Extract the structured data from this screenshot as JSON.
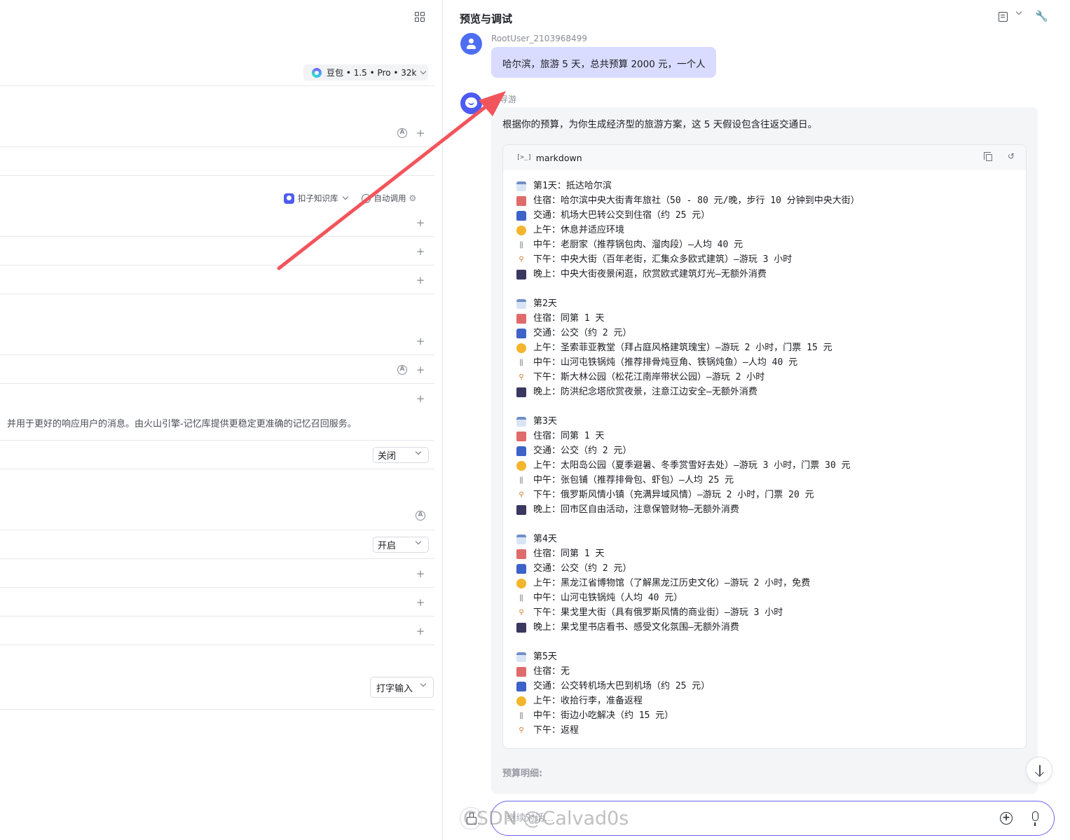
{
  "left_panel": {
    "model_chip": "豆包 • 1.5 • Pro • 32k",
    "knowledge": {
      "kb_label": "扣子知识库",
      "auto_label": "自动调用"
    },
    "memory_description": "并用于更好的响应用户的消息。由火山引擎-记忆库提供更稳定更准确的记忆召回服务。",
    "select_close": "关闭",
    "select_open": "开启",
    "select_input_mode": "打字输入"
  },
  "right_panel": {
    "title": "预览与调试",
    "user": {
      "name": "RootUser_2103968499",
      "message": "哈尔滨，旅游 5 天，总共预算 2000 元，一个人"
    },
    "bot": {
      "name_partial": "能导游",
      "intro": "根据你的预算，为你生成经济型的旅游方案，这 5 天假设包含往返交通日。",
      "code_lang": "markdown",
      "code_lines": [
        {
          "icon": "calendar",
          "text": "第1天：抵达哈尔滨"
        },
        {
          "icon": "hotel",
          "text": "住宿：哈尔滨中央大街青年旅社（50 - 80 元/晚，步行 10 分钟到中央大街）"
        },
        {
          "icon": "bus",
          "text": "交通：机场大巴转公交到住宿（约 25 元）"
        },
        {
          "icon": "sun",
          "text": "上午：休息并适应环境"
        },
        {
          "icon": "fork",
          "text": "中午：老厨家（推荐锅包肉、溜肉段）—人均 40 元"
        },
        {
          "icon": "bike",
          "text": "下午：中央大街（百年老街，汇集众多欧式建筑）—游玩 3 小时"
        },
        {
          "icon": "night",
          "text": "晚上：中央大街夜景闲逛，欣赏欧式建筑灯光—无额外消费"
        },
        {
          "icon": "",
          "text": ""
        },
        {
          "icon": "calendar",
          "text": "第2天"
        },
        {
          "icon": "hotel",
          "text": "住宿：同第 1 天"
        },
        {
          "icon": "bus",
          "text": "交通：公交（约 2 元）"
        },
        {
          "icon": "sun",
          "text": "上午：圣索菲亚教堂（拜占庭风格建筑瑰宝）—游玩 2 小时，门票 15 元"
        },
        {
          "icon": "fork",
          "text": "中午：山河屯铁锅炖（推荐排骨炖豆角、铁锅炖鱼）—人均 40 元"
        },
        {
          "icon": "bike",
          "text": "下午：斯大林公园（松花江南岸带状公园）—游玩 2 小时"
        },
        {
          "icon": "night",
          "text": "晚上：防洪纪念塔欣赏夜景，注意江边安全—无额外消费"
        },
        {
          "icon": "",
          "text": ""
        },
        {
          "icon": "calendar",
          "text": "第3天"
        },
        {
          "icon": "hotel",
          "text": "住宿：同第 1 天"
        },
        {
          "icon": "bus",
          "text": "交通：公交（约 2 元）"
        },
        {
          "icon": "sun",
          "text": "上午：太阳岛公园（夏季避暑、冬季赏雪好去处）—游玩 3 小时，门票 30 元"
        },
        {
          "icon": "fork",
          "text": "中午：张包铺（推荐排骨包、虾包）—人均 25 元"
        },
        {
          "icon": "bike",
          "text": "下午：俄罗斯风情小镇（充满异域风情）—游玩 2 小时，门票 20 元"
        },
        {
          "icon": "night",
          "text": "晚上：回市区自由活动，注意保管财物—无额外消费"
        },
        {
          "icon": "",
          "text": ""
        },
        {
          "icon": "calendar",
          "text": "第4天"
        },
        {
          "icon": "hotel",
          "text": "住宿：同第 1 天"
        },
        {
          "icon": "bus",
          "text": "交通：公交（约 2 元）"
        },
        {
          "icon": "sun",
          "text": "上午：黑龙江省博物馆（了解黑龙江历史文化）—游玩 2 小时，免费"
        },
        {
          "icon": "fork",
          "text": "中午：山河屯铁锅炖（人均 40 元）"
        },
        {
          "icon": "bike",
          "text": "下午：果戈里大街（具有俄罗斯风情的商业街）—游玩 3 小时"
        },
        {
          "icon": "night",
          "text": "晚上：果戈里书店看书、感受文化氛围—无额外消费"
        },
        {
          "icon": "",
          "text": ""
        },
        {
          "icon": "calendar",
          "text": "第5天"
        },
        {
          "icon": "hotel",
          "text": "住宿：无"
        },
        {
          "icon": "bus",
          "text": "交通：公交转机场大巴到机场（约 25 元）"
        },
        {
          "icon": "sun",
          "text": "上午：收拾行李，准备返程"
        },
        {
          "icon": "fork",
          "text": "中午：街边小吃解决（约 15 元）"
        },
        {
          "icon": "bike",
          "text": "下午：返程"
        }
      ],
      "budget_label": "预算明细:"
    },
    "input_placeholder": "继续对话...",
    "watermark": "CSDN @Calvad0s"
  },
  "colors": {
    "accent": "#4e5bf2",
    "user_bubble": "#d9dcfe",
    "annotation_arrow": "#f2545b"
  }
}
